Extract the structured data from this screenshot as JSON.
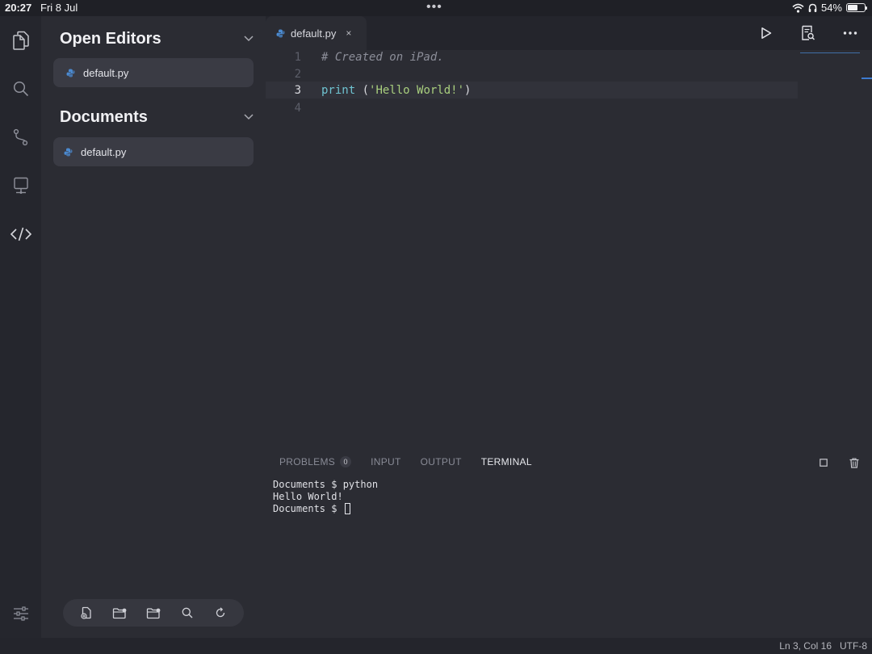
{
  "status_bar": {
    "time": "20:27",
    "date": "Fri 8 Jul",
    "battery": "54%",
    "battery_level": 0.54
  },
  "sidebar": {
    "open_editors": {
      "title": "Open Editors",
      "files": [
        "default.py"
      ]
    },
    "documents": {
      "title": "Documents",
      "files": [
        "default.py"
      ]
    }
  },
  "editor": {
    "tab": {
      "label": "default.py",
      "close": "×"
    },
    "lines": [
      {
        "number": "1",
        "text": "# Created on iPad."
      },
      {
        "number": "2",
        "text": ""
      },
      {
        "number": "3",
        "fn": "print",
        "plain": " (",
        "str": "'Hello World!'",
        "close": ")"
      },
      {
        "number": "4",
        "text": ""
      }
    ]
  },
  "panel": {
    "tabs": {
      "problems": "PROBLEMS",
      "problems_count": "0",
      "input": "INPUT",
      "output": "OUTPUT",
      "terminal": "TERMINAL"
    },
    "terminal_lines": [
      "Documents $ python",
      "Hello World!",
      "Documents $ "
    ]
  },
  "status": {
    "position": "Ln 3, Col 16",
    "encoding": "UTF-8"
  },
  "colors": {
    "accent": "#3d7bd0",
    "string": "#a9cf7e",
    "function": "#6fc3d1"
  }
}
